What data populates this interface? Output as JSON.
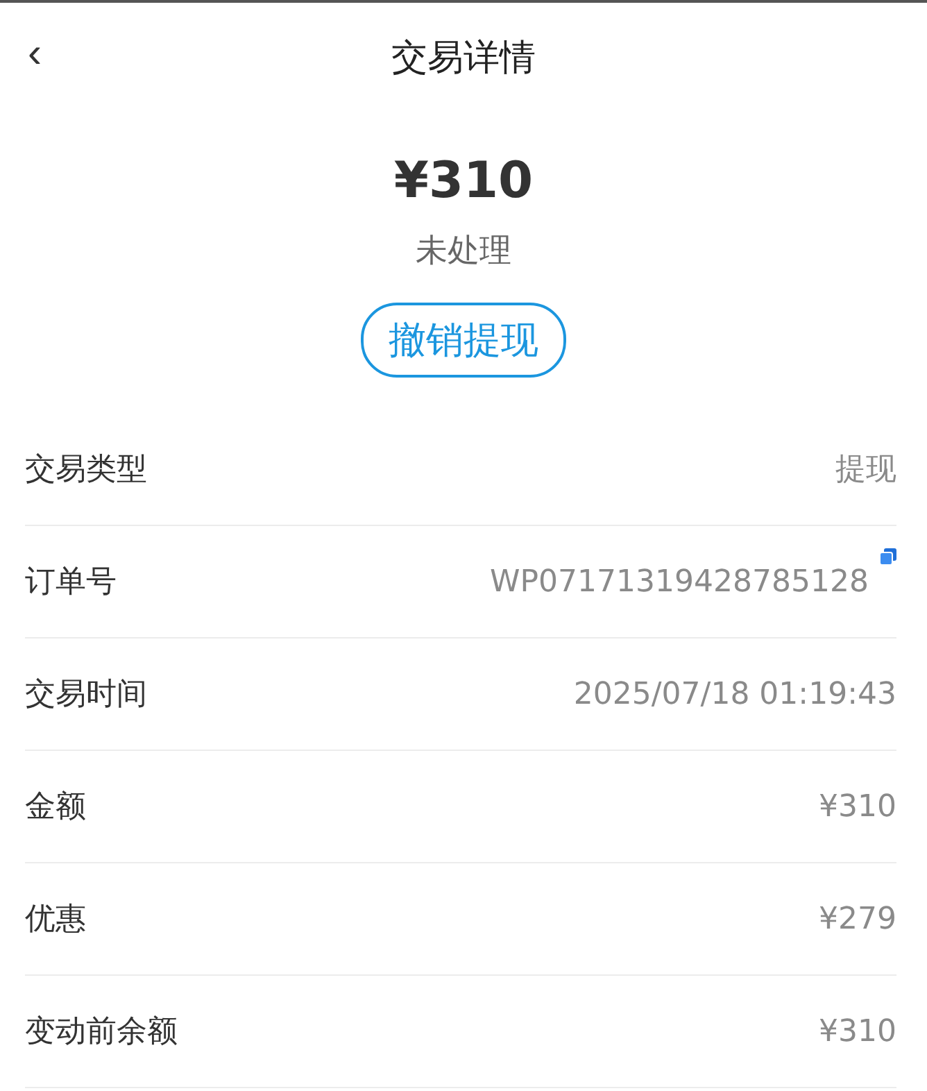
{
  "header": {
    "back": "‹",
    "title": "交易详情"
  },
  "summary": {
    "amount": "¥310",
    "status": "未处理",
    "action": "撤销提现"
  },
  "rows": [
    {
      "label": "交易类型",
      "value": "提现",
      "copyable": false
    },
    {
      "label": "订单号",
      "value": "WP07171319428785128",
      "copyable": true
    },
    {
      "label": "交易时间",
      "value": "2025/07/18 01:19:43",
      "copyable": false
    },
    {
      "label": "金额",
      "value": "¥310",
      "copyable": false
    },
    {
      "label": "优惠",
      "value": "¥279",
      "copyable": false
    },
    {
      "label": "变动前余额",
      "value": "¥310",
      "copyable": false
    }
  ]
}
